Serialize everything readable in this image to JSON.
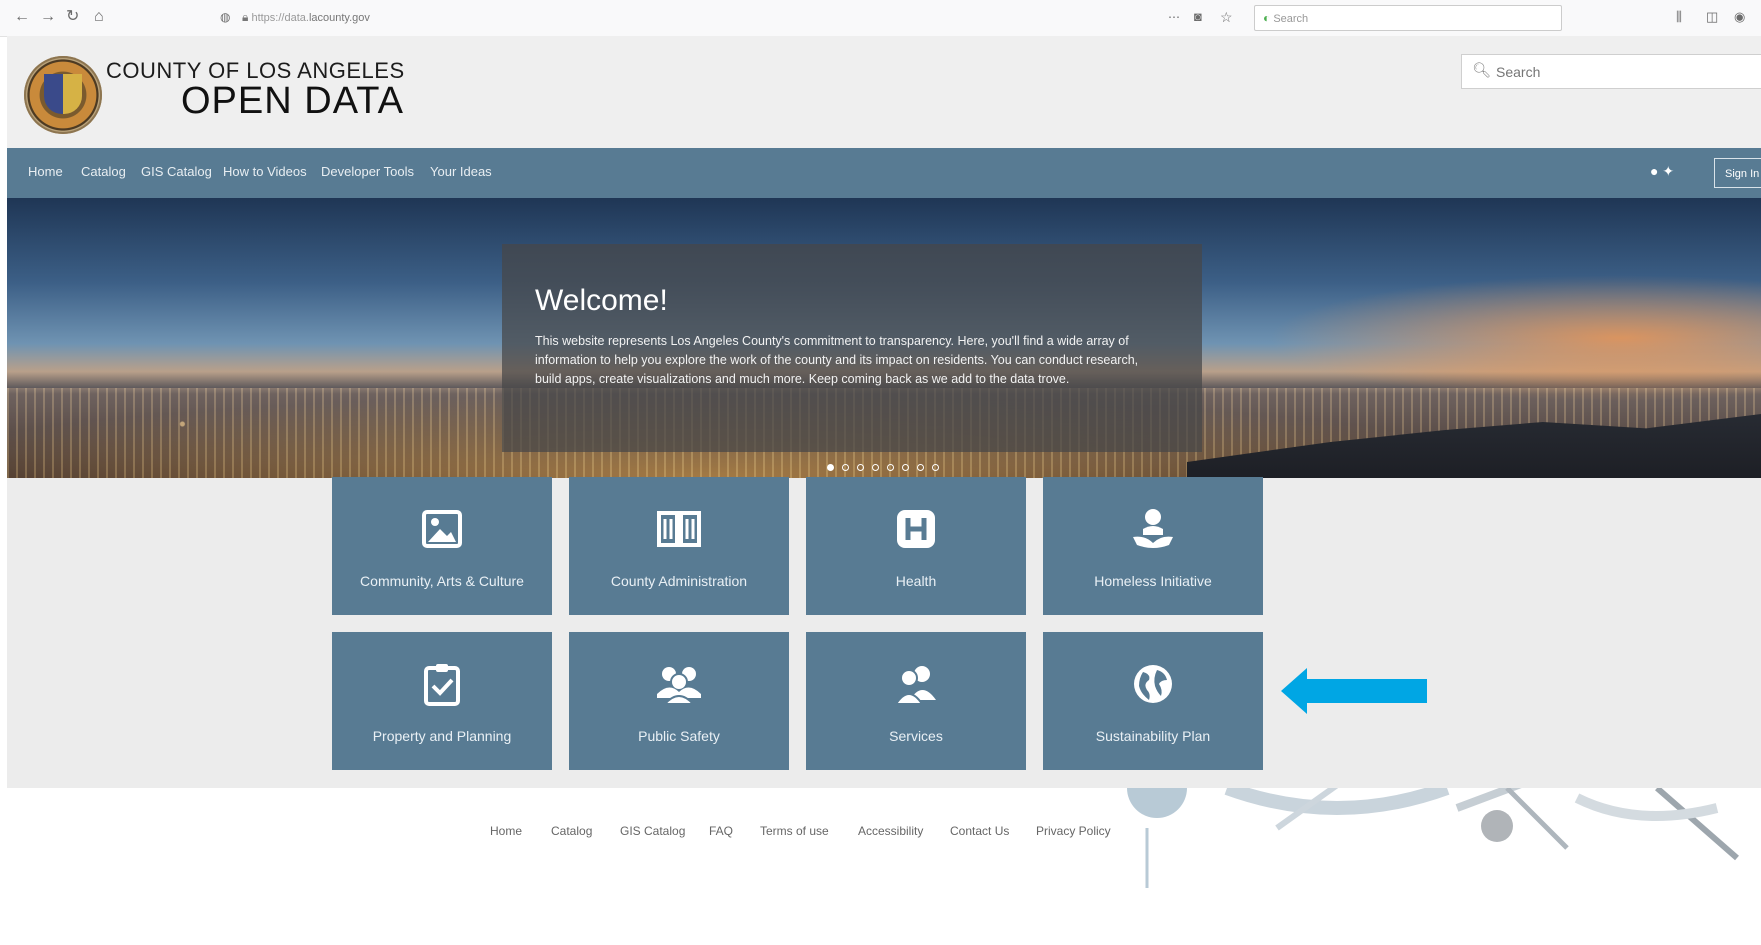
{
  "browser": {
    "url_prefix": "https://data.",
    "url_domain": "lacounty.gov",
    "search_placeholder": "Search"
  },
  "header": {
    "county_name": "COUNTY OF LOS ANGELES",
    "site_title": "OPEN DATA",
    "search_placeholder": "Search"
  },
  "nav": {
    "items": [
      "Home",
      "Catalog",
      "GIS Catalog",
      "How to Videos",
      "Developer Tools",
      "Your Ideas"
    ],
    "sign_in": "Sign In"
  },
  "hero": {
    "title": "Welcome!",
    "text": "This website represents Los Angeles County's commitment to transparency. Here, you'll find a wide array of information to help you explore the work of the county and its impact on residents. You can conduct research, build apps, create visualizations and much more. Keep coming back as we add to the data trove.",
    "slide_count": 8,
    "active_slide": 1
  },
  "tiles": [
    {
      "label": "Community, Arts & Culture",
      "icon": "image-icon"
    },
    {
      "label": "County Administration",
      "icon": "book-icon"
    },
    {
      "label": "Health",
      "icon": "hospital-icon"
    },
    {
      "label": "Homeless Initiative",
      "icon": "hand-person-icon"
    },
    {
      "label": "Property and Planning",
      "icon": "clipboard-check-icon"
    },
    {
      "label": "Public Safety",
      "icon": "group-icon"
    },
    {
      "label": "Services",
      "icon": "users-icon"
    },
    {
      "label": "Sustainability Plan",
      "icon": "globe-icon"
    }
  ],
  "annotation": {
    "arrow_color": "#00a6e4"
  },
  "footer": {
    "links": [
      "Home",
      "Catalog",
      "GIS Catalog",
      "FAQ",
      "Terms of use",
      "Accessibility",
      "Contact Us",
      "Privacy Policy"
    ]
  },
  "colors": {
    "nav_bg": "#587b93",
    "tile_bg": "#587b93"
  }
}
